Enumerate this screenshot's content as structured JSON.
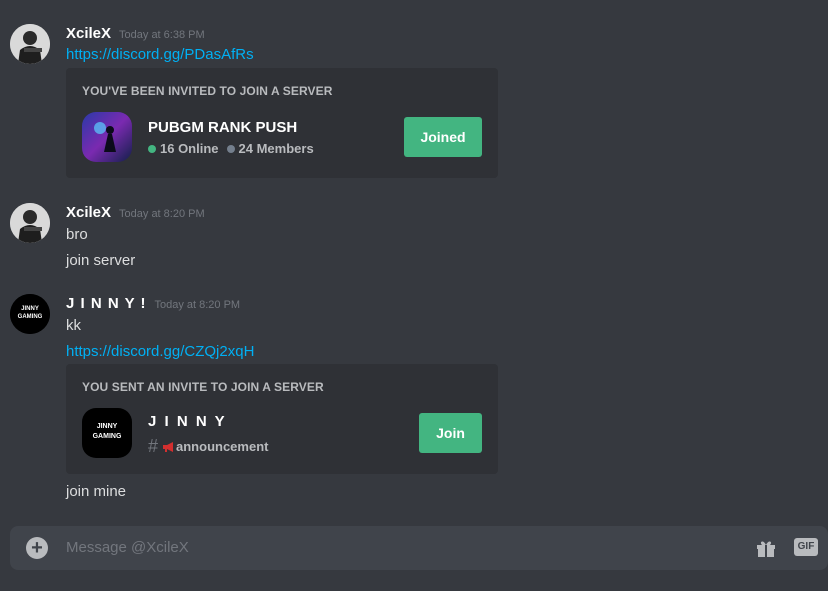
{
  "messages": [
    {
      "author": "XcileX",
      "timestamp": "Today at 6:38 PM",
      "link": "https://discord.gg/PDasAfRs",
      "invite": {
        "header": "YOU'VE BEEN INVITED TO JOIN A SERVER",
        "server_name": "PUBGM RANK PUSH",
        "online": "16 Online",
        "members": "24 Members",
        "button": "Joined"
      }
    },
    {
      "author": "XcileX",
      "timestamp": "Today at 8:20 PM",
      "lines": [
        "bro",
        "join server"
      ]
    },
    {
      "author": "J I N N Y !",
      "timestamp": "Today at 8:20 PM",
      "avatar_text": "JINNY GAMING",
      "lines": [
        "kk"
      ],
      "link": "https://discord.gg/CZQj2xqH",
      "invite": {
        "header": "YOU SENT AN INVITE TO JOIN A SERVER",
        "server_name": "J I N N Y",
        "icon_text": "JINNY GAMING",
        "channel": "announcement",
        "button": "Join"
      },
      "after": "join mine"
    }
  ],
  "composer": {
    "placeholder": "Message @XcileX",
    "gif_label": "GIF"
  },
  "colors": {
    "background": "#36393f",
    "embed": "#2f3136",
    "link": "#00b0f4",
    "button": "#43b581",
    "online": "#43b581",
    "members": "#747f8d"
  },
  "icons": [
    "plus-icon",
    "gift-icon",
    "gif-icon",
    "hashtag-icon",
    "megaphone-icon"
  ]
}
